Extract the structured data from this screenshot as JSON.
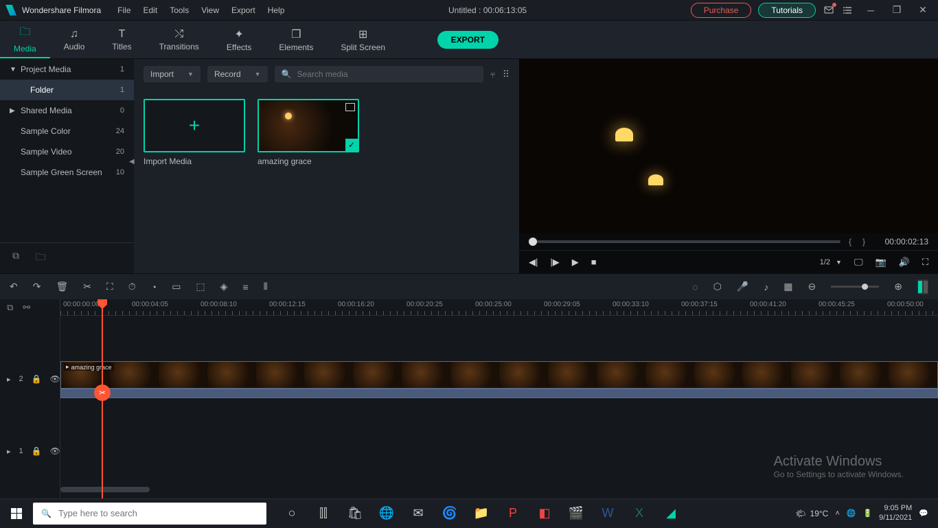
{
  "app": {
    "name": "Wondershare Filmora"
  },
  "menu": {
    "file": "File",
    "edit": "Edit",
    "tools": "Tools",
    "view": "View",
    "export": "Export",
    "help": "Help"
  },
  "title": {
    "project": "Untitled : 00:06:13:05"
  },
  "buttons": {
    "purchase": "Purchase",
    "tutorials": "Tutorials",
    "export": "EXPORT"
  },
  "tabs": {
    "media": "Media",
    "audio": "Audio",
    "titles": "Titles",
    "transitions": "Transitions",
    "effects": "Effects",
    "elements": "Elements",
    "splitscreen": "Split Screen"
  },
  "sidebar": {
    "items": [
      {
        "label": "Project Media",
        "count": "1",
        "chev": "▼"
      },
      {
        "label": "Folder",
        "count": "1"
      },
      {
        "label": "Shared Media",
        "count": "0",
        "chev": "▶"
      },
      {
        "label": "Sample Color",
        "count": "24"
      },
      {
        "label": "Sample Video",
        "count": "20"
      },
      {
        "label": "Sample Green Screen",
        "count": "10"
      }
    ]
  },
  "mediaToolbar": {
    "import": "Import",
    "record": "Record",
    "searchPlaceholder": "Search media"
  },
  "mediaCards": {
    "importLabel": "Import Media",
    "clip1": "amazing grace"
  },
  "preview": {
    "time": "00:00:02:13",
    "ratio": "1/2",
    "braceL": "{",
    "braceR": "}"
  },
  "ruler": [
    "00:00:00:00",
    "00:00:04:05",
    "00:00:08:10",
    "00:00:12:15",
    "00:00:16:20",
    "00:00:20:25",
    "00:00:25:00",
    "00:00:29:05",
    "00:00:33:10",
    "00:00:37:15",
    "00:00:41:20",
    "00:00:45:25",
    "00:00:50:00"
  ],
  "tracks": {
    "t2": "2",
    "t1": "1"
  },
  "clip": {
    "name": "amazing grace"
  },
  "watermark": {
    "l1": "Activate Windows",
    "l2": "Go to Settings to activate Windows."
  },
  "taskbar": {
    "searchPlaceholder": "Type here to search",
    "temp": "19°C",
    "time": "9:05 PM",
    "date": "9/11/2021"
  }
}
